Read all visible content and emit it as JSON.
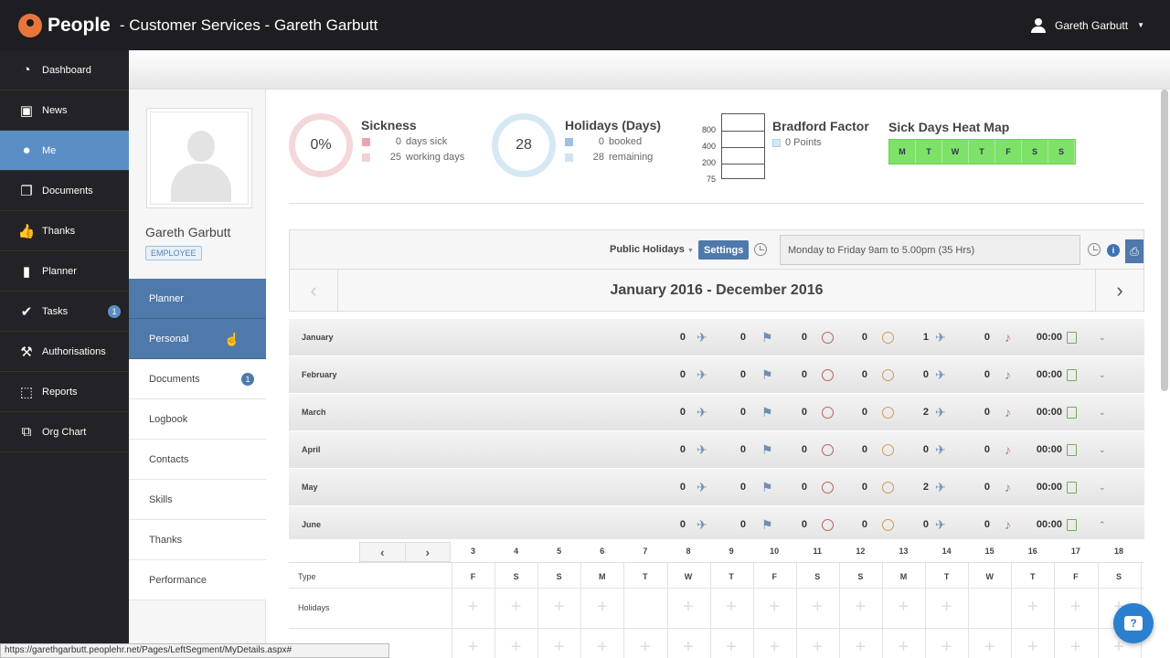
{
  "topbar": {
    "brand": "People",
    "title": "- Customer Services - Gareth Garbutt",
    "user": "Gareth Garbutt",
    "caret": "▼"
  },
  "sidebar": {
    "items": [
      {
        "label": "Dashboard",
        "icon": "◔",
        "icon_name": "dashboard-icon"
      },
      {
        "label": "News",
        "icon": "▣",
        "icon_name": "tv-icon"
      },
      {
        "label": "Me",
        "icon": "●",
        "icon_name": "user-icon",
        "active": true
      },
      {
        "label": "Documents",
        "icon": "❐",
        "icon_name": "documents-icon"
      },
      {
        "label": "Thanks",
        "icon": "👍",
        "icon_name": "thumbs-up-icon"
      },
      {
        "label": "Planner",
        "icon": "▮",
        "icon_name": "planner-icon"
      },
      {
        "label": "Tasks",
        "icon": "✔",
        "icon_name": "check-icon",
        "badge": "1"
      },
      {
        "label": "Authorisations",
        "icon": "⚒",
        "icon_name": "gavel-icon"
      },
      {
        "label": "Reports",
        "icon": "⬚",
        "icon_name": "reports-icon"
      },
      {
        "label": "Org Chart",
        "icon": "⧉",
        "icon_name": "org-chart-icon"
      }
    ]
  },
  "profile": {
    "name": "Gareth Garbutt",
    "role": "EMPLOYEE"
  },
  "submenu": [
    {
      "label": "Planner",
      "active": true
    },
    {
      "label": "Personal",
      "active": true
    },
    {
      "label": "Documents",
      "badge": "1"
    },
    {
      "label": "Logbook"
    },
    {
      "label": "Contacts"
    },
    {
      "label": "Skills"
    },
    {
      "label": "Thanks"
    },
    {
      "label": "Performance"
    }
  ],
  "summary": {
    "sickness": {
      "title": "Sickness",
      "ring": "0%",
      "days_sick": "0",
      "days_sick_label": "days sick",
      "working_days": "25",
      "working_days_label": "working days"
    },
    "holidays": {
      "title": "Holidays (Days)",
      "ring": "28",
      "booked": "0",
      "booked_label": "booked",
      "remaining": "28",
      "remaining_label": "remaining"
    },
    "bradford": {
      "title": "Bradford Factor",
      "points": "0 Points",
      "axis": [
        "800",
        "400",
        "200",
        "75"
      ]
    },
    "heatmap": {
      "title": "Sick Days Heat Map",
      "days": [
        "M",
        "T",
        "W",
        "T",
        "F",
        "S",
        "S"
      ]
    }
  },
  "toolbar": {
    "public_holidays": "Public Holidays",
    "settings": "Settings",
    "schedule": "Monday to Friday 9am to 5.00pm (35 Hrs)",
    "info": "i"
  },
  "year": {
    "title": "January 2016 - December 2016",
    "prev": "‹",
    "next": "›"
  },
  "months": [
    {
      "name": "January",
      "v1": "0",
      "v2": "0",
      "v3": "0",
      "v4": "0",
      "v5": "1",
      "v6": "0",
      "time": "00:00",
      "chev": "⌄"
    },
    {
      "name": "February",
      "v1": "0",
      "v2": "0",
      "v3": "0",
      "v4": "0",
      "v5": "0",
      "v6": "0",
      "time": "00:00",
      "chev": "⌄"
    },
    {
      "name": "March",
      "v1": "0",
      "v2": "0",
      "v3": "0",
      "v4": "0",
      "v5": "2",
      "v6": "0",
      "time": "00:00",
      "chev": "⌄"
    },
    {
      "name": "April",
      "v1": "0",
      "v2": "0",
      "v3": "0",
      "v4": "0",
      "v5": "0",
      "v6": "0",
      "time": "00:00",
      "chev": "⌄"
    },
    {
      "name": "May",
      "v1": "0",
      "v2": "0",
      "v3": "0",
      "v4": "0",
      "v5": "2",
      "v6": "0",
      "time": "00:00",
      "chev": "⌄"
    },
    {
      "name": "June",
      "v1": "0",
      "v2": "0",
      "v3": "0",
      "v4": "0",
      "v5": "0",
      "v6": "0",
      "time": "00:00",
      "chev": "⌃"
    }
  ],
  "grid": {
    "nav_prev": "‹",
    "nav_next": "›",
    "dates": [
      "3",
      "4",
      "5",
      "6",
      "7",
      "8",
      "9",
      "10",
      "11",
      "12",
      "13",
      "14",
      "15",
      "16",
      "17",
      "18"
    ],
    "days": [
      "F",
      "S",
      "S",
      "M",
      "T",
      "W",
      "T",
      "F",
      "S",
      "S",
      "M",
      "T",
      "W",
      "T",
      "F",
      "S"
    ],
    "type_label": "Type",
    "holidays_label": "Holidays",
    "plus": "+"
  },
  "status_url": "https://garethgarbutt.peoplehr.net/Pages/LeftSegment/MyDetails.aspx#",
  "chat": "?",
  "colors": {
    "accent": "#5b8ec4",
    "topbar": "#1d1d22",
    "heat": "#7ee268"
  }
}
